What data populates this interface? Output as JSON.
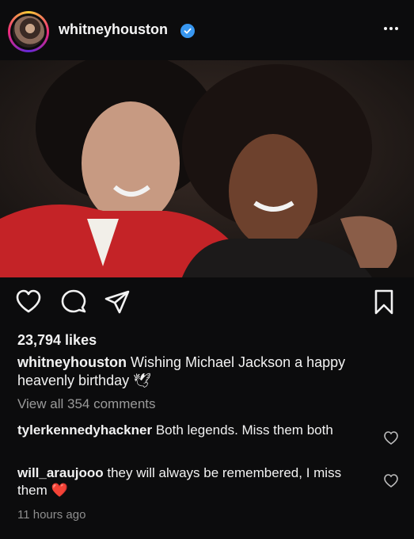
{
  "post": {
    "username": "whitneyhouston",
    "likes": "23,794 likes",
    "caption_user": "whitneyhouston",
    "caption_text": "Wishing Michael Jackson a happy heavenly birthday",
    "caption_emoji": "🕊",
    "view_all": "View all 354 comments",
    "timestamp": "11 hours ago"
  },
  "comments": [
    {
      "user": "tylerkennedyhackner",
      "text": "Both legends. Miss them both"
    },
    {
      "user": "will_araujooo",
      "text": "they will always be remembered, I miss them",
      "emoji": "❤️"
    }
  ],
  "icons": {
    "like": "heart-icon",
    "comment": "comment-icon",
    "share": "paper-plane-icon",
    "save": "bookmark-icon",
    "verified": "verified-badge-icon",
    "more": "more-options-icon"
  },
  "colors": {
    "background": "#0c0c0d",
    "verified": "#3897f0",
    "heart_emoji": "#e0245e"
  }
}
